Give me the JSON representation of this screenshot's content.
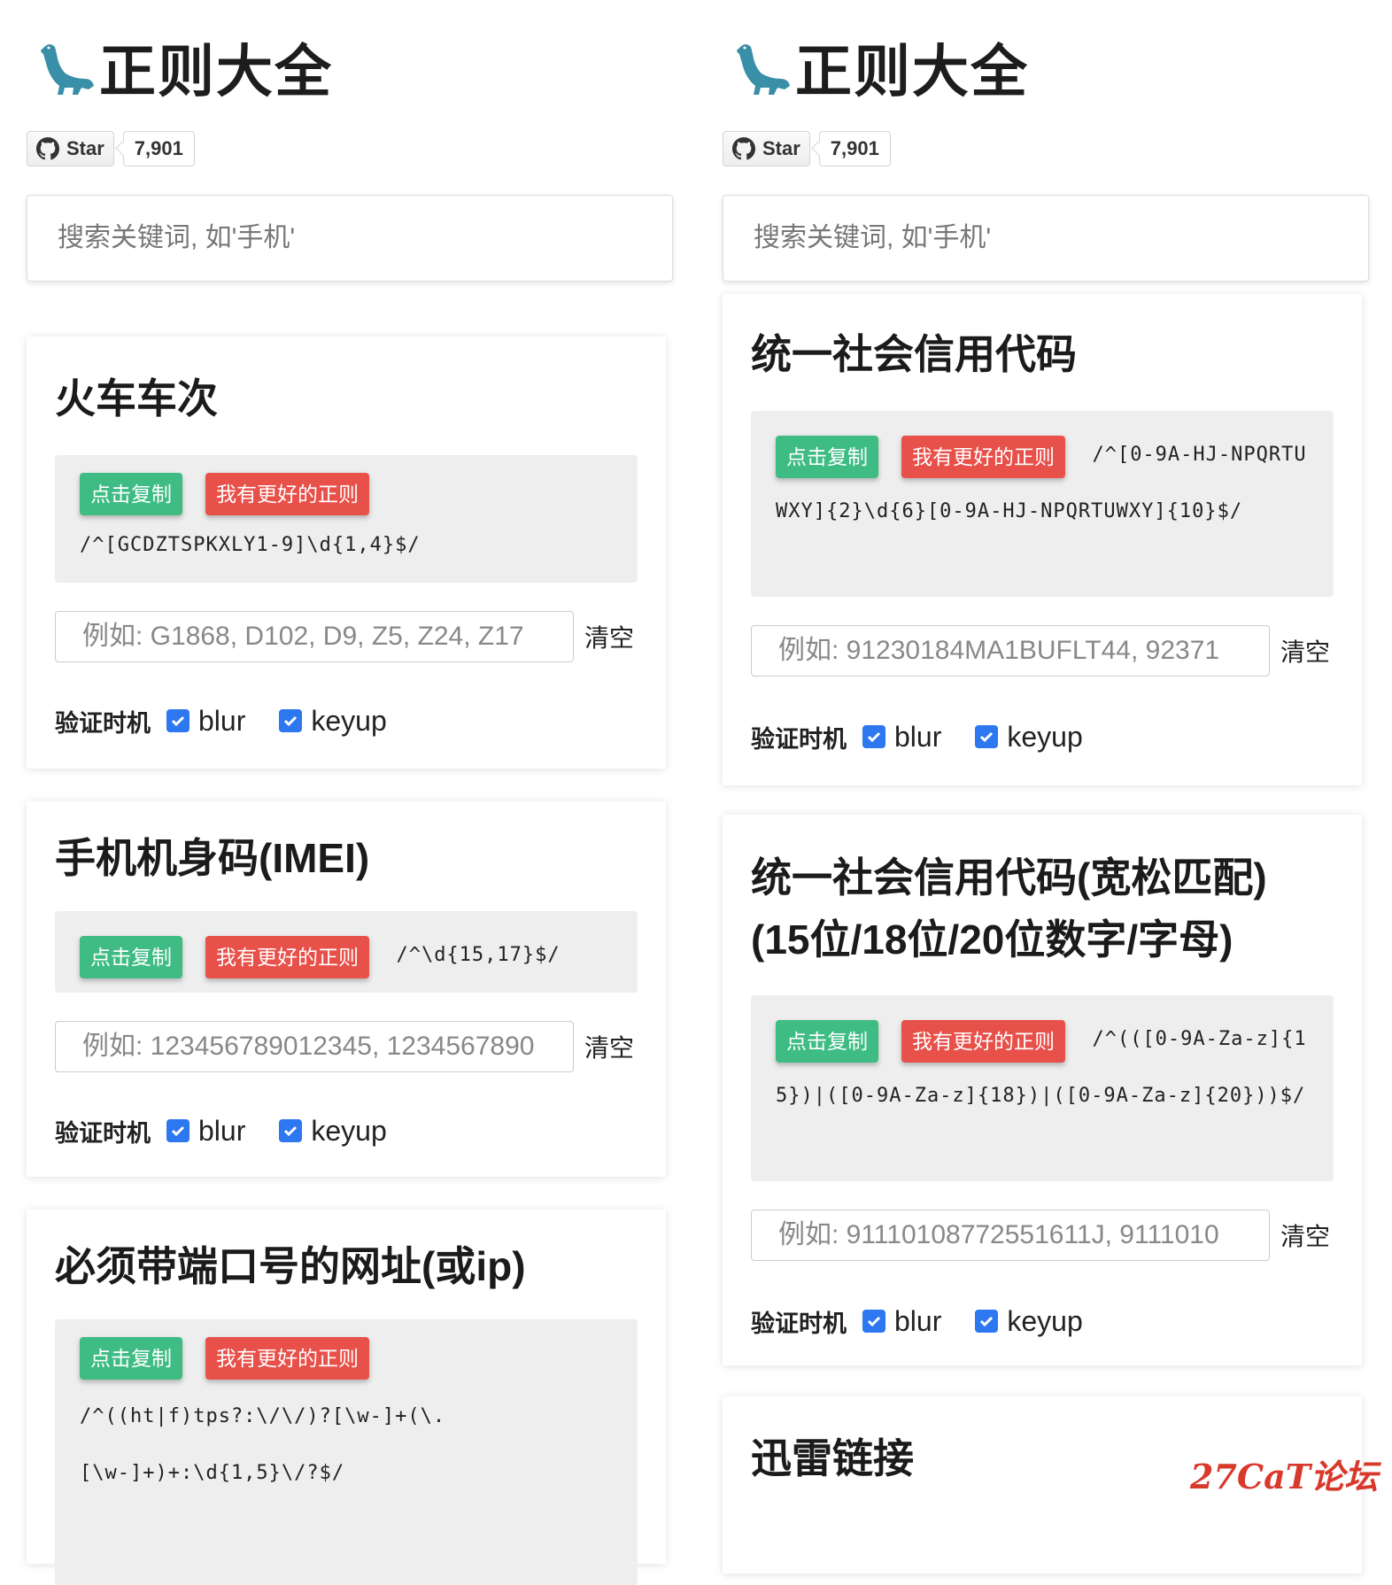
{
  "app": {
    "title": "正则大全",
    "github": {
      "star_label": "Star",
      "star_count": "7,901"
    },
    "search_placeholder": "搜索关键词, 如'手机'"
  },
  "labels": {
    "copy": "点击复制",
    "better": "我有更好的正则",
    "clear": "清空",
    "trigger": "验证时机",
    "blur": "blur",
    "keyup": "keyup"
  },
  "left_cards": [
    {
      "title": "火车车次",
      "regex": "/^[GCDZTSPKXLY1-9]\\d{1,4}$/",
      "example": "例如: G1868, D102, D9, Z5, Z24, Z17"
    },
    {
      "title": "手机机身码(IMEI)",
      "regex": "/^\\d{15,17}$/",
      "example": "例如: 123456789012345, 1234567890"
    },
    {
      "title": "必须带端口号的网址(或ip)",
      "regex": "/^((ht|f)tps?:\\/\\/)?[\\w-]+(\\.[\\w-]+)+:\\d{1,5}\\/?$/"
    }
  ],
  "right_cards": [
    {
      "title": "统一社会信用代码",
      "regex": "/^[0-9A-HJ-NPQRTUWXY]{2}\\d{6}[0-9A-HJ-NPQRTUWXY]{10}$/",
      "example": "例如: 91230184MA1BUFLT44, 92371"
    },
    {
      "title": "统一社会信用代码(宽松匹配)(15位/18位/20位数字/字母)",
      "regex": "/^(([0-9A-Za-z]{15})|([0-9A-Za-z]{18})|([0-9A-Za-z]{20}))$/",
      "example": "例如: 91110108772551611J, 9111010"
    },
    {
      "title": "迅雷链接"
    }
  ],
  "watermark": "27CaT论坛",
  "colors": {
    "copy_btn": "#3ebc84",
    "better_btn": "#e8504a",
    "checkbox": "#2d77f0"
  }
}
